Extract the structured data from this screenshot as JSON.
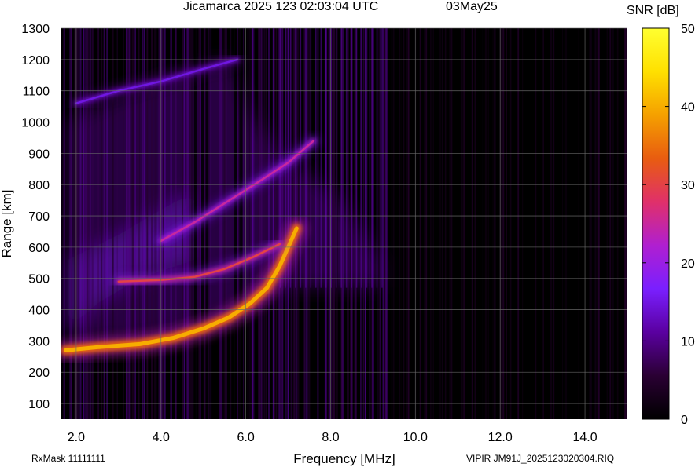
{
  "header": {
    "title": "Jicamarca 2025 123 02:03:04 UTC",
    "date": "03May25"
  },
  "footer": {
    "rx_mask": "RxMask 11111111",
    "file_label": "VIPIR  JM91J_2025123020304.RIQ"
  },
  "colorbar": {
    "label": "SNR [dB]",
    "ticks": [
      "50",
      "40",
      "30",
      "20",
      "10",
      "0"
    ],
    "range": [
      0,
      50
    ],
    "colors": [
      "#000000",
      "#2a0033",
      "#5a00a0",
      "#7a1fff",
      "#b01fd0",
      "#e0306a",
      "#e85c10",
      "#f5a000",
      "#ffe000",
      "#ffff30"
    ]
  },
  "chart_data": {
    "type": "heatmap",
    "title": "Jicamarca 2025 123 02:03:04 UTC",
    "xlabel": "Frequency [MHz]",
    "ylabel": "Range [km]",
    "xlim": [
      1.65,
      15.0
    ],
    "ylim": [
      50,
      1300
    ],
    "x_ticks": [
      "2.0",
      "4.0",
      "6.0",
      "8.0",
      "10.0",
      "12.0",
      "14.0"
    ],
    "y_ticks": [
      "100",
      "200",
      "300",
      "400",
      "500",
      "600",
      "700",
      "800",
      "900",
      "1000",
      "1100",
      "1200",
      "1300"
    ],
    "grid": true,
    "value_label": "SNR [dB]",
    "traces": [
      {
        "description": "O-mode F-layer echo",
        "peak_snr": 40,
        "points": [
          [
            1.75,
            270
          ],
          [
            2.5,
            280
          ],
          [
            3.5,
            290
          ],
          [
            4.3,
            310
          ],
          [
            5.0,
            340
          ],
          [
            5.6,
            375
          ],
          [
            6.1,
            420
          ],
          [
            6.5,
            470
          ],
          [
            6.8,
            540
          ],
          [
            7.0,
            600
          ],
          [
            7.2,
            660
          ]
        ]
      },
      {
        "description": "second-hop echo",
        "peak_snr": 30,
        "points": [
          [
            3.0,
            490
          ],
          [
            4.0,
            495
          ],
          [
            4.8,
            505
          ],
          [
            5.5,
            530
          ],
          [
            6.2,
            570
          ],
          [
            6.8,
            610
          ]
        ]
      },
      {
        "description": "upper echo band",
        "peak_snr": 25,
        "points": [
          [
            4.0,
            620
          ],
          [
            4.8,
            680
          ],
          [
            5.5,
            740
          ],
          [
            6.2,
            800
          ],
          [
            7.0,
            870
          ],
          [
            7.6,
            940
          ]
        ]
      },
      {
        "description": "high range diffuse band",
        "peak_snr": 15,
        "points": [
          [
            2.0,
            1060
          ],
          [
            3.0,
            1100
          ],
          [
            4.0,
            1130
          ],
          [
            5.0,
            1170
          ],
          [
            5.8,
            1200
          ]
        ]
      }
    ]
  }
}
